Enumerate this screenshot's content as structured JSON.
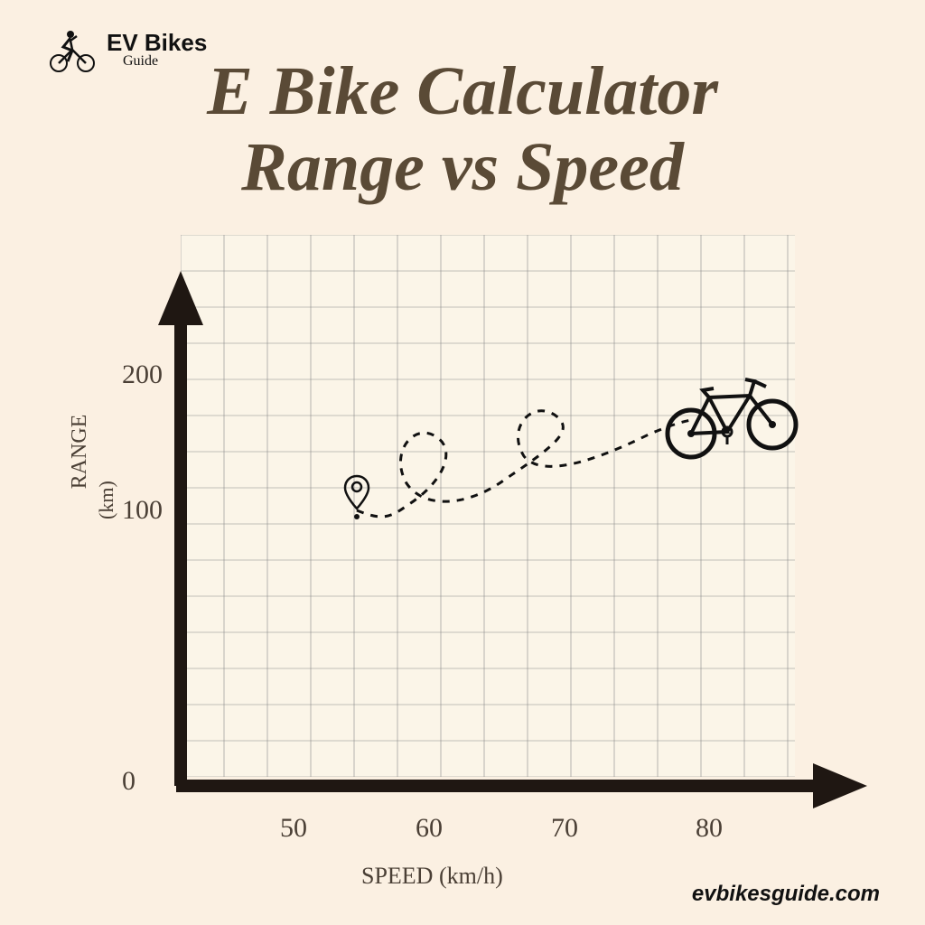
{
  "logo": {
    "title": "EV Bikes",
    "subtitle": "Guide"
  },
  "title_line1": "E Bike Calculator",
  "title_line2": "Range vs Speed",
  "ylabel": "RANGE",
  "yunit": "(km)",
  "xlabel": "SPEED (km/h)",
  "y_ticks": [
    "0",
    "100",
    "200"
  ],
  "x_ticks": [
    "50",
    "60",
    "70",
    "80"
  ],
  "footer": "evbikesguide.com",
  "chart_data": {
    "type": "line",
    "title": "E Bike Calculator Range vs Speed",
    "xlabel": "SPEED (km/h)",
    "ylabel": "RANGE (km)",
    "xlim": [
      40,
      85
    ],
    "ylim": [
      0,
      280
    ],
    "x_ticks": [
      50,
      60,
      70,
      80
    ],
    "y_ticks": [
      0,
      100,
      200
    ],
    "grid": true,
    "series": [
      {
        "name": "path",
        "x": [
          50,
          73
        ],
        "y": [
          100,
          175
        ],
        "style": "dashed-swirl"
      }
    ],
    "annotations": [
      {
        "type": "pin",
        "x": 50,
        "y": 105
      },
      {
        "type": "bike",
        "x": 75,
        "y": 180
      }
    ]
  }
}
